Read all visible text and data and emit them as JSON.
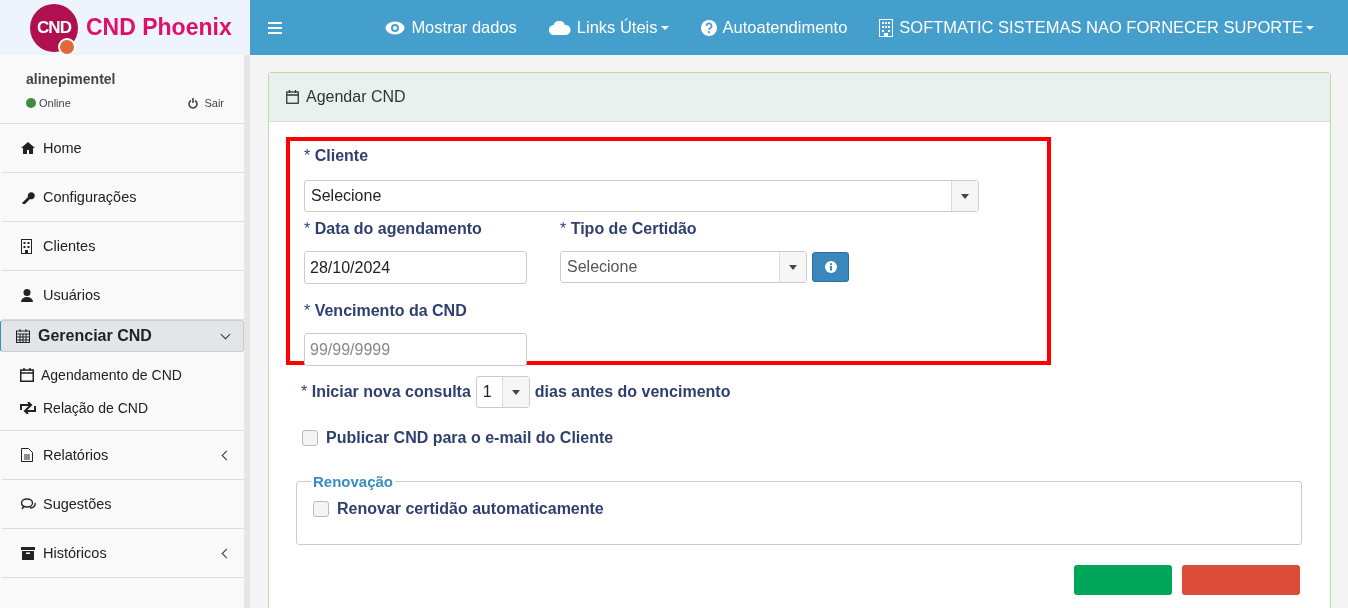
{
  "brand": {
    "logo_text": "CND",
    "name": "CND Phoenix"
  },
  "topbar": {
    "items": [
      {
        "label": "Mostrar dados",
        "dropdown": false
      },
      {
        "label": "Links Úteis",
        "dropdown": true
      },
      {
        "label": "Autoatendimento",
        "dropdown": false
      },
      {
        "label": "SOFTMATIC SISTEMAS NAO FORNECER SUPORTE",
        "dropdown": true
      }
    ]
  },
  "user": {
    "name": "alinepimentel",
    "status": {
      "label": "Online",
      "color": "#3c8d3c"
    },
    "logout": "Sair"
  },
  "sidebar": {
    "items": [
      {
        "label": "Home",
        "kind": "link",
        "selected": false
      },
      {
        "label": "Configurações",
        "kind": "link",
        "selected": false
      },
      {
        "label": "Clientes",
        "kind": "link",
        "selected": false
      },
      {
        "label": "Usuários",
        "kind": "link",
        "selected": false
      },
      {
        "label": "Gerenciar CND",
        "kind": "group",
        "selected": true,
        "expanded": true,
        "children": [
          {
            "label": "Agendamento de CND"
          },
          {
            "label": "Relação de CND"
          }
        ]
      },
      {
        "label": "Relatórios",
        "kind": "group",
        "selected": false,
        "expanded": false
      },
      {
        "label": "Sugestões",
        "kind": "link",
        "selected": false
      },
      {
        "label": "Históricos",
        "kind": "group",
        "selected": false,
        "expanded": false
      }
    ]
  },
  "panel": {
    "title": "Agendar CND",
    "cliente": {
      "mark": "*",
      "label": "Cliente",
      "value": "Selecione"
    },
    "data": {
      "mark": "*",
      "label": "Data do agendamento",
      "value": "28/10/2024"
    },
    "tipo": {
      "mark": "*",
      "label": "Tipo de Certidão",
      "value": "Selecione"
    },
    "vencimento": {
      "mark": "*",
      "label": "Vencimento da CND",
      "placeholder": "99/99/9999"
    },
    "consulta": {
      "mark": "*",
      "label": "Iniciar nova consulta",
      "value": "1",
      "suffix": "dias antes do vencimento"
    },
    "publicar": {
      "label": "Publicar CND para o e-mail do Cliente",
      "checked": false
    },
    "renovacao": {
      "legend": "Renovação",
      "label": "Renovar certidão automaticamente",
      "checked": false
    }
  }
}
